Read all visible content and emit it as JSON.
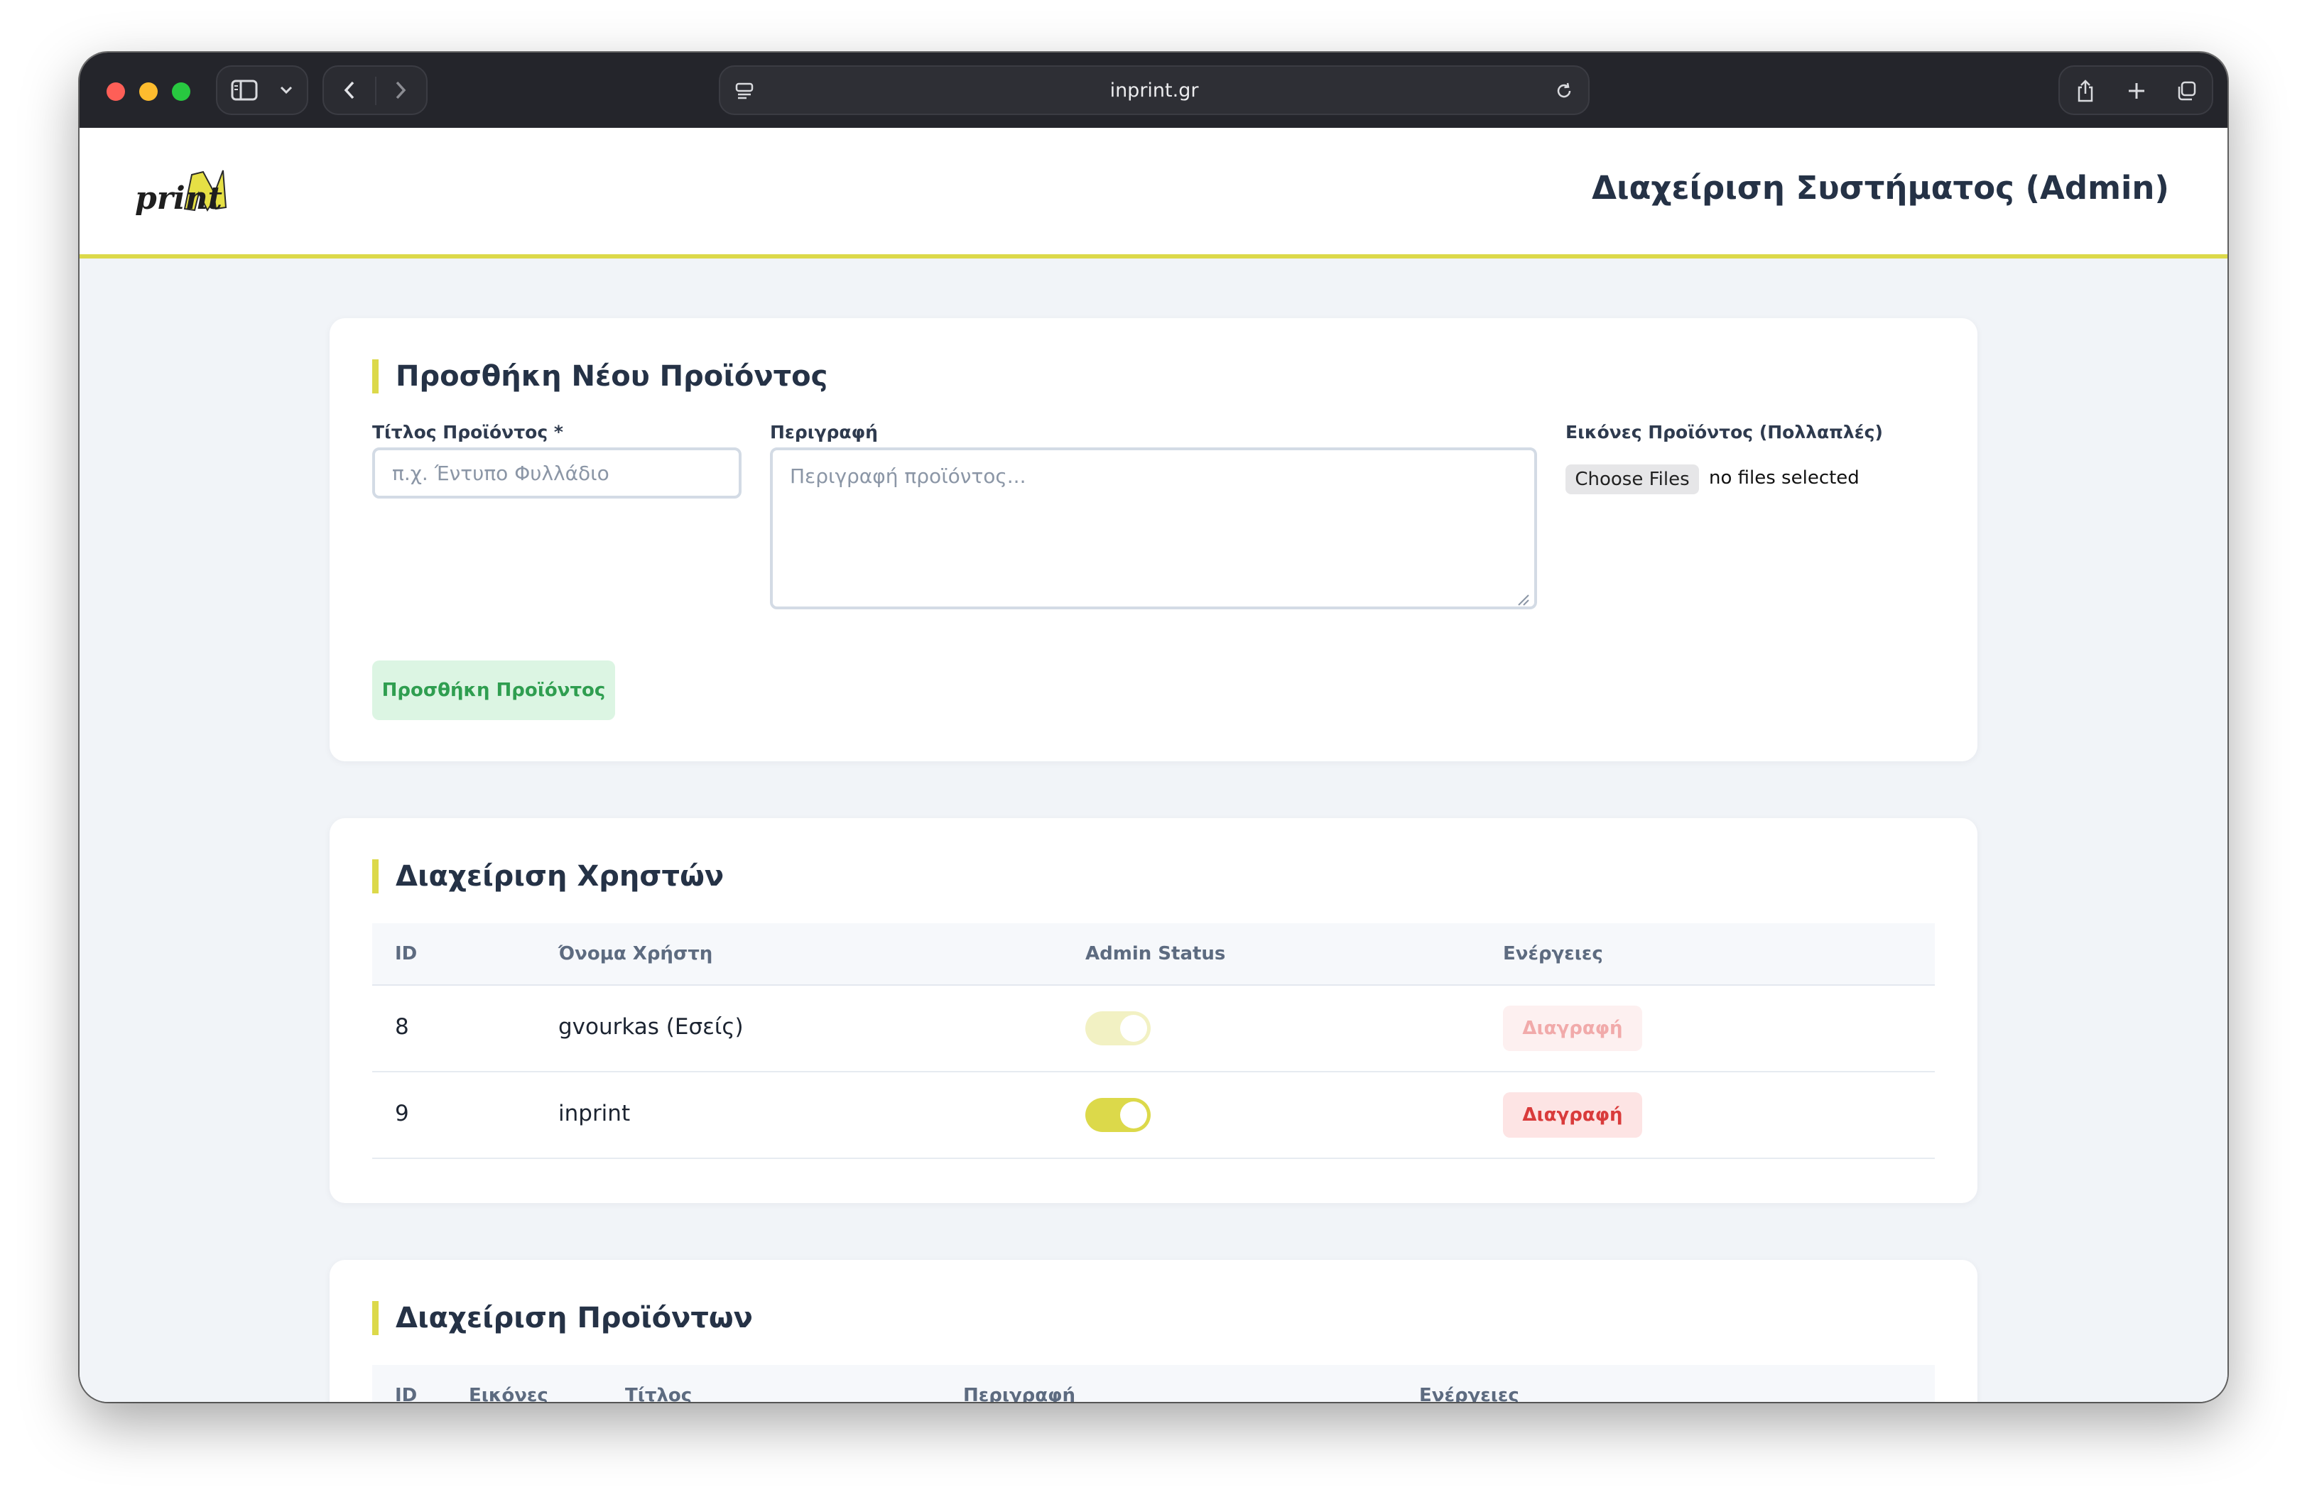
{
  "browser": {
    "url": "inprint.gr",
    "icons": {
      "sidebar": "sidebar-icon",
      "chevron": "chevron-down-icon",
      "back": "back-icon",
      "forward": "forward-icon",
      "page_menu": "page-menu-icon",
      "reload": "reload-icon",
      "share": "share-icon",
      "new_tab": "new-tab-icon",
      "tabs": "tab-overview-icon"
    }
  },
  "header": {
    "logo_text": "print",
    "title": "Διαχείριση Συστήματος (Admin)"
  },
  "add_product": {
    "title": "Προσθήκη Νέου Προϊόντος",
    "title_label": "Τίτλος Προϊόντος *",
    "title_placeholder": "π.χ. Έντυπο Φυλλάδιο",
    "description_label": "Περιγραφή",
    "description_placeholder": "Περιγραφή προϊόντος...",
    "images_label": "Εικόνες Προϊόντος (Πολλαπλές)",
    "choose_files_label": "Choose Files",
    "files_status": "no files selected",
    "submit_label": "Προσθήκη Προϊόντος"
  },
  "users": {
    "title": "Διαχείριση Χρηστών",
    "columns": [
      "ID",
      "Όνομα Χρήστη",
      "Admin Status",
      "Ενέργειες"
    ],
    "rows": [
      {
        "id": "8",
        "username": "gvourkas (Εσείς)",
        "admin": true,
        "disabled": true,
        "action": "Διαγραφή"
      },
      {
        "id": "9",
        "username": "inprint",
        "admin": true,
        "disabled": false,
        "action": "Διαγραφή"
      }
    ]
  },
  "products": {
    "title": "Διαχείριση Προϊόντων",
    "columns": [
      "ID",
      "Εικόνες",
      "Τίτλος",
      "Περιγραφή",
      "Ενέργειες"
    ]
  },
  "colors": {
    "accent": "#dcd94a",
    "heading": "#253246",
    "success_bg": "#dcf5e3",
    "success_text": "#2f9e50",
    "danger_bg": "#fde4e4",
    "danger_text": "#d93b3b"
  }
}
